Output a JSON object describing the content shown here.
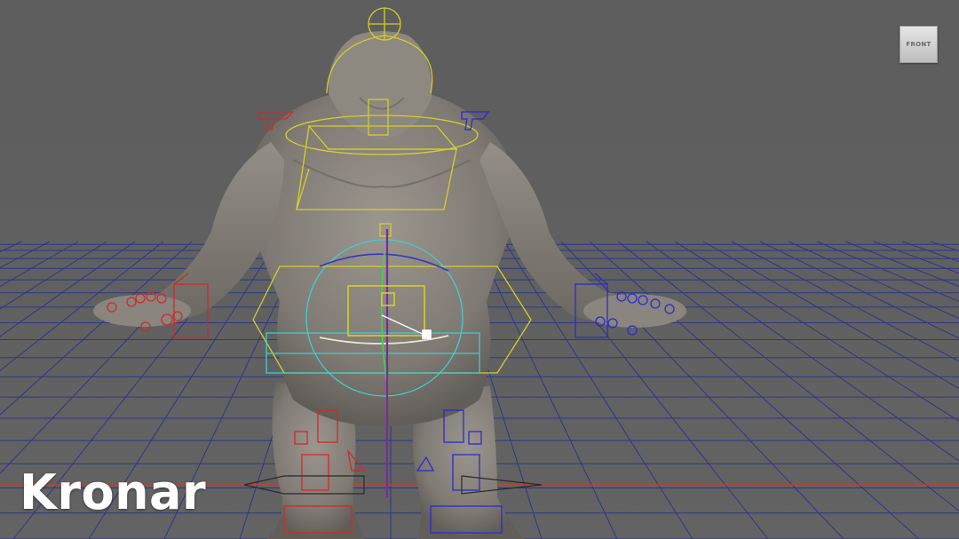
{
  "viewport": {
    "view_cube_label": "FRONT",
    "colors": {
      "background": "#5f5f5f",
      "grid": "#1e2a8c",
      "grid_secondary": "#2f2f6a",
      "axis_x": "#c0392b",
      "mesh": "#8a857e",
      "control_center": "#d8d42a",
      "control_left": "#d22b2b",
      "control_right": "#2b2bd2",
      "control_root": "#35c7c7",
      "joint": "#6f2b8a"
    }
  },
  "watermark": {
    "text": "Kronar"
  }
}
